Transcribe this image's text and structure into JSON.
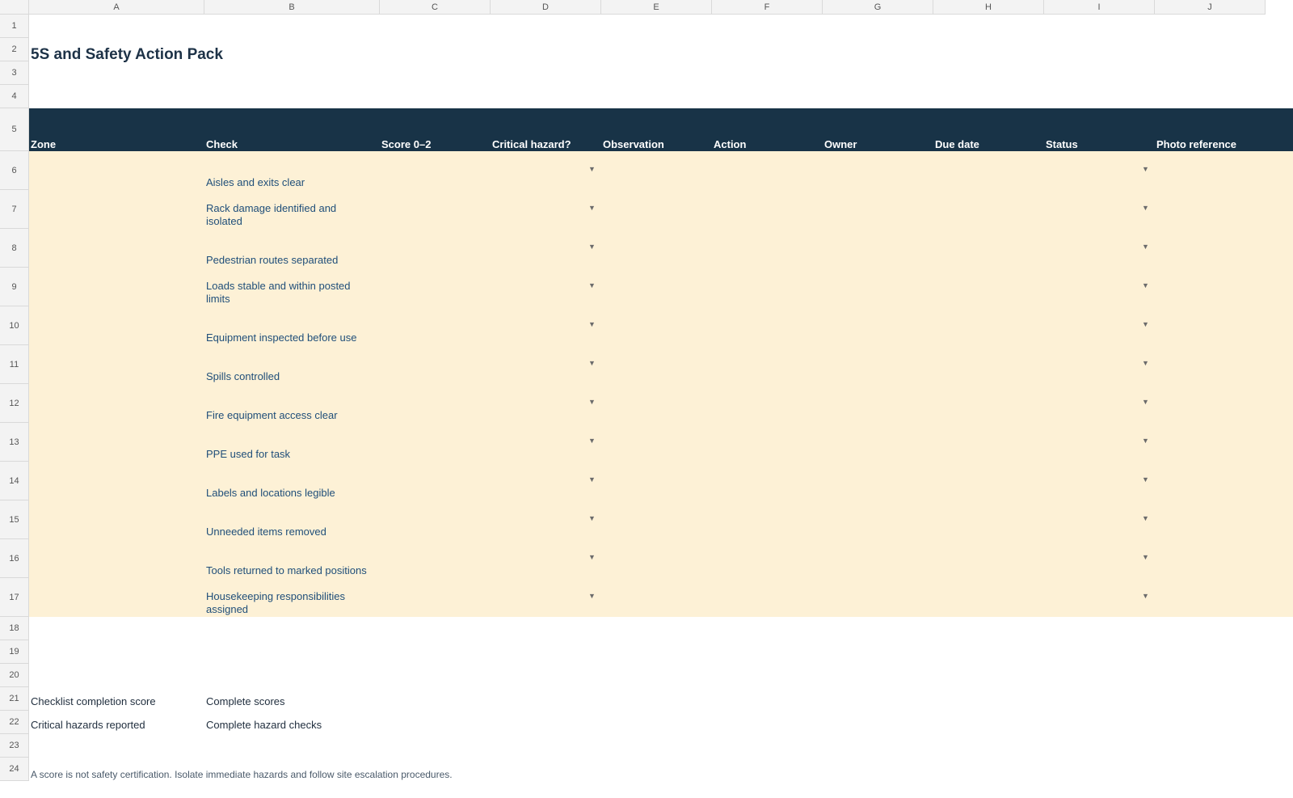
{
  "columns": [
    "A",
    "B",
    "C",
    "D",
    "E",
    "F",
    "G",
    "H",
    "I",
    "J"
  ],
  "rows": [
    "1",
    "2",
    "3",
    "4",
    "5",
    "6",
    "7",
    "8",
    "9",
    "10",
    "11",
    "12",
    "13",
    "14",
    "15",
    "16",
    "17",
    "18",
    "19",
    "20",
    "21",
    "22",
    "23",
    "24"
  ],
  "title": "5S and Safety Action Pack",
  "headers": [
    "Zone",
    "Check",
    "Score 0–2",
    "Critical hazard?",
    "Observation",
    "Action",
    "Owner",
    "Due date",
    "Status",
    "Photo reference"
  ],
  "checks": [
    "Aisles and exits clear",
    "Rack damage identified and isolated",
    "Pedestrian routes separated",
    "Loads stable and within posted limits",
    "Equipment inspected before use",
    "Spills controlled",
    "Fire equipment access clear",
    "PPE used for task",
    "Labels and locations legible",
    "Unneeded items removed",
    "Tools returned to marked positions",
    "Housekeeping responsibilities assigned"
  ],
  "dropdown_glyph": "▼",
  "summary": [
    {
      "label": "Checklist completion score",
      "value": "Complete scores"
    },
    {
      "label": "Critical hazards reported",
      "value": "Complete hazard checks"
    }
  ],
  "note": "A score is not safety certification. Isolate immediate hazards and follow site escalation procedures.",
  "colors": {
    "header_bg": "#183347",
    "data_bg": "#fdf1d6",
    "check_text": "#1f4e79"
  }
}
